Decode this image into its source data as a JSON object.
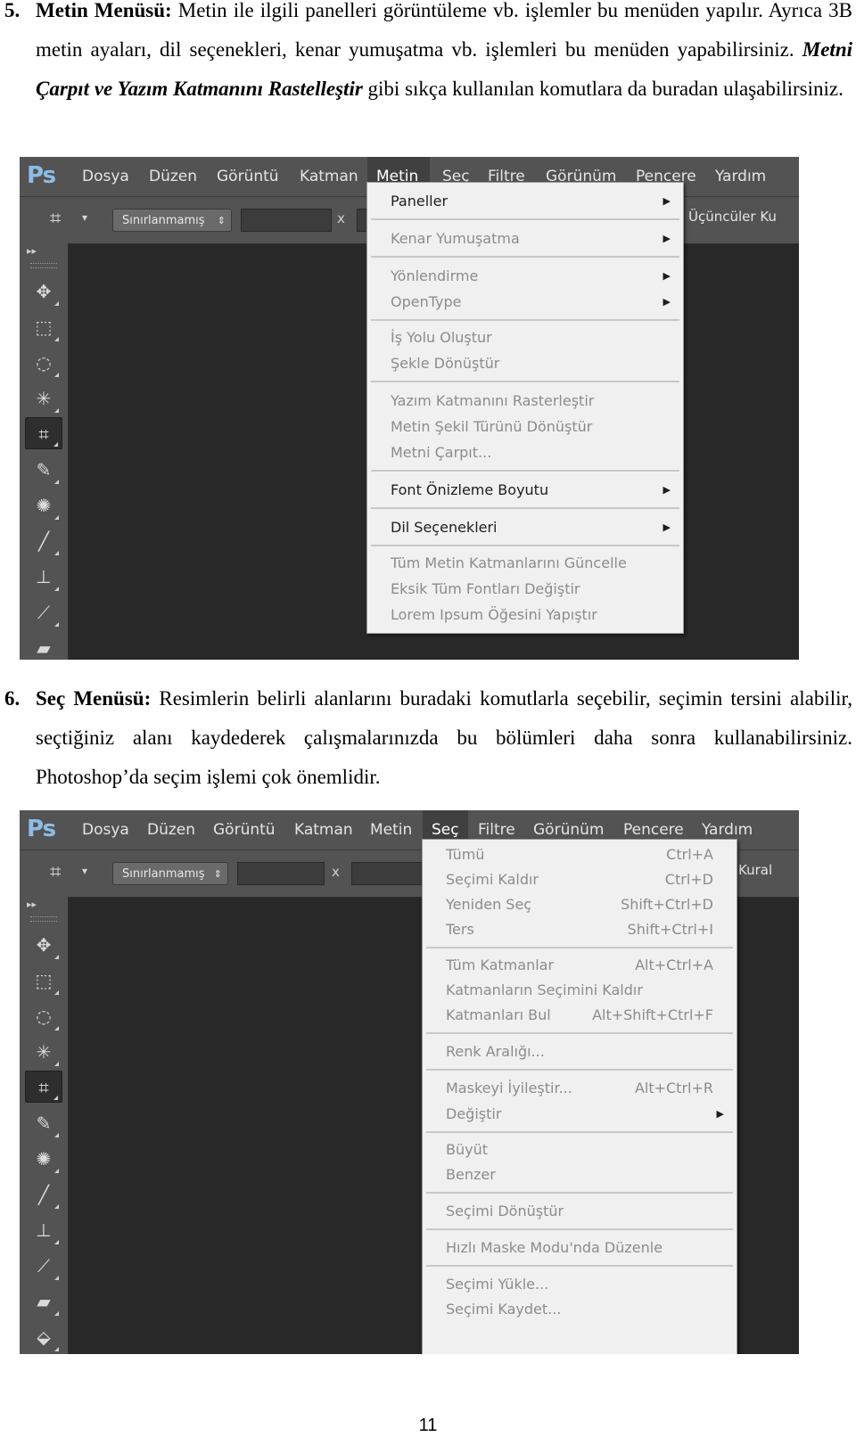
{
  "section5": {
    "number": "5.",
    "title": "Metin Menüsü:",
    "text1": " Metin ile ilgili panelleri görüntüleme vb. işlemler bu menüden yapılır. Ayrıca 3B metin ayaları, dil seçenekleri, kenar yumuşatma vb. işlemleri bu menüden yapabilirsiniz. ",
    "emphasis": "Metni Çarpıt ve Yazım Katmanını Rastelleştir",
    "text2": " gibi sıkça kullanılan komutlara da buradan ulaşabilirsiniz."
  },
  "section6": {
    "number": "6.",
    "title": "Seç Menüsü:",
    "text": " Resimlerin belirli alanlarını buradaki komutlarla seçebilir, seçimin tersini alabilir, seçtiğiniz alanı kaydederek çalışmalarınızda bu bölümleri daha sonra kullanabilirsiniz. Photoshop’da seçim işlemi çok önemlidir."
  },
  "app": {
    "logo": "Ps",
    "menu": [
      "Dosya",
      "Düzen",
      "Görüntü",
      "Katman",
      "Metin",
      "Seç",
      "Filtre",
      "Görünüm",
      "Pencere",
      "Yardım"
    ],
    "ratio_select": "Sınırlanmamış",
    "x_label": "x",
    "shot1_right_label": "Üçüncüler Ku",
    "shot2_right_label": "Kural"
  },
  "menu_metin": {
    "items": [
      {
        "label": "Paneller",
        "enabled": true,
        "submenu": true
      },
      {
        "label": "Kenar Yumuşatma",
        "enabled": false,
        "submenu": true
      },
      {
        "label": "Yönlendirme",
        "enabled": false,
        "submenu": true
      },
      {
        "label": "OpenType",
        "enabled": false,
        "submenu": true
      },
      {
        "label": "İş Yolu Oluştur",
        "enabled": false
      },
      {
        "label": "Şekle Dönüştür",
        "enabled": false
      },
      {
        "label": "Yazım Katmanını Rasterleştir",
        "enabled": false
      },
      {
        "label": "Metin Şekil Türünü Dönüştür",
        "enabled": false
      },
      {
        "label": "Metni Çarpıt...",
        "enabled": false
      },
      {
        "label": "Font Önizleme Boyutu",
        "enabled": true,
        "submenu": true
      },
      {
        "label": "Dil Seçenekleri",
        "enabled": true,
        "submenu": true
      },
      {
        "label": "Tüm Metin Katmanlarını Güncelle",
        "enabled": false
      },
      {
        "label": "Eksik Tüm Fontları Değiştir",
        "enabled": false
      },
      {
        "label": "Lorem Ipsum Öğesini Yapıştır",
        "enabled": false
      }
    ]
  },
  "menu_sec": {
    "items": [
      {
        "label": "Tümü",
        "shortcut": "Ctrl+A",
        "enabled": false
      },
      {
        "label": "Seçimi Kaldır",
        "shortcut": "Ctrl+D",
        "enabled": false
      },
      {
        "label": "Yeniden Seç",
        "shortcut": "Shift+Ctrl+D",
        "enabled": false
      },
      {
        "label": "Ters",
        "shortcut": "Shift+Ctrl+I",
        "enabled": false
      },
      {
        "label": "Tüm Katmanlar",
        "shortcut": "Alt+Ctrl+A",
        "enabled": false
      },
      {
        "label": "Katmanların Seçimini Kaldır",
        "shortcut": "",
        "enabled": false
      },
      {
        "label": "Katmanları Bul",
        "shortcut": "Alt+Shift+Ctrl+F",
        "enabled": false
      },
      {
        "label": "Renk Aralığı...",
        "shortcut": "",
        "enabled": false
      },
      {
        "label": "Maskeyi İyileştir...",
        "shortcut": "Alt+Ctrl+R",
        "enabled": false
      },
      {
        "label": "Değiştir",
        "shortcut": "",
        "enabled": false,
        "submenu": true
      },
      {
        "label": "Büyüt",
        "shortcut": "",
        "enabled": false
      },
      {
        "label": "Benzer",
        "shortcut": "",
        "enabled": false
      },
      {
        "label": "Seçimi Dönüştür",
        "shortcut": "",
        "enabled": false
      },
      {
        "label": "Hızlı Maske Modu'nda Düzenle",
        "shortcut": "",
        "enabled": false
      },
      {
        "label": "Seçimi Yükle...",
        "shortcut": "",
        "enabled": false
      },
      {
        "label": "Seçimi Kaydet...",
        "shortcut": "",
        "enabled": false
      }
    ]
  },
  "page_number": "11"
}
